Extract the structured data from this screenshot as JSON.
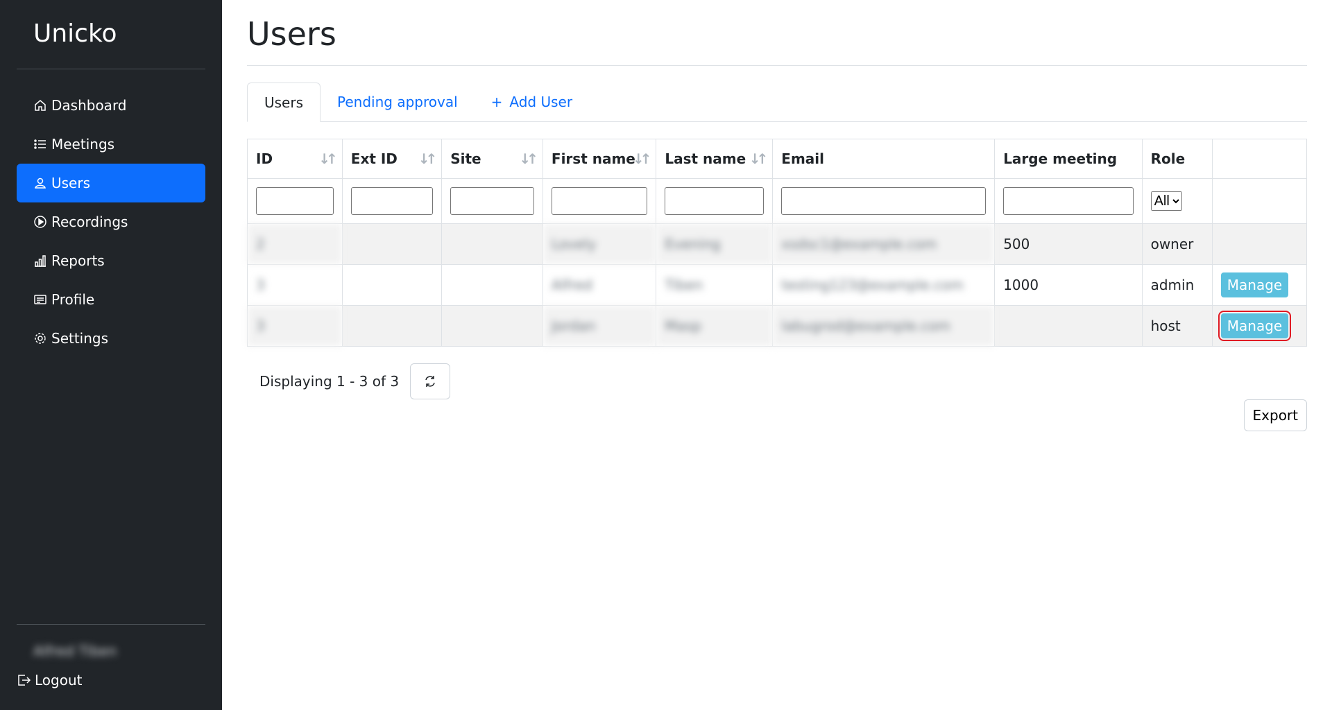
{
  "app": {
    "brand": "Unicko"
  },
  "sidebar": {
    "items": [
      {
        "label": "Dashboard",
        "icon": "house-icon"
      },
      {
        "label": "Meetings",
        "icon": "list-icon"
      },
      {
        "label": "Users",
        "icon": "person-icon",
        "active": true
      },
      {
        "label": "Recordings",
        "icon": "play-circle-icon"
      },
      {
        "label": "Reports",
        "icon": "bar-chart-icon"
      },
      {
        "label": "Profile",
        "icon": "card-text-icon"
      },
      {
        "label": "Settings",
        "icon": "gear-icon"
      }
    ],
    "user_name": "Alfred Tiben",
    "logout_label": "Logout"
  },
  "main": {
    "title": "Users",
    "tabs": [
      {
        "label": "Users",
        "active": true
      },
      {
        "label": "Pending approval"
      },
      {
        "label": "Add User",
        "prefix": "+"
      }
    ],
    "table": {
      "columns": [
        "ID",
        "Ext ID",
        "Site",
        "First name",
        "Last name",
        "Email",
        "Large meeting",
        "Role"
      ],
      "role_filter_selected": "All",
      "rows": [
        {
          "id": "2",
          "ext_id": "",
          "site": "",
          "first_name": "Lovely",
          "last_name": "Evening",
          "email": "xsdsc1@example.com",
          "large_meeting": "500",
          "role": "owner",
          "action": ""
        },
        {
          "id": "3",
          "ext_id": "",
          "site": "",
          "first_name": "Alfred",
          "last_name": "Tiben",
          "email": "testing123@example.com",
          "large_meeting": "1000",
          "role": "admin",
          "action": "Manage"
        },
        {
          "id": "3",
          "ext_id": "",
          "site": "",
          "first_name": "Jordan",
          "last_name": "Masp",
          "email": "labugrod@example.com",
          "large_meeting": "",
          "role": "host",
          "action": "Manage"
        }
      ]
    },
    "footer": {
      "displaying": "Displaying 1 - 3 of 3"
    },
    "export_label": "Export"
  },
  "colors": {
    "sidebar_bg": "#212529",
    "active_nav": "#0d6efd",
    "manage_button": "#5bc0de",
    "highlight": "#e01b24"
  }
}
